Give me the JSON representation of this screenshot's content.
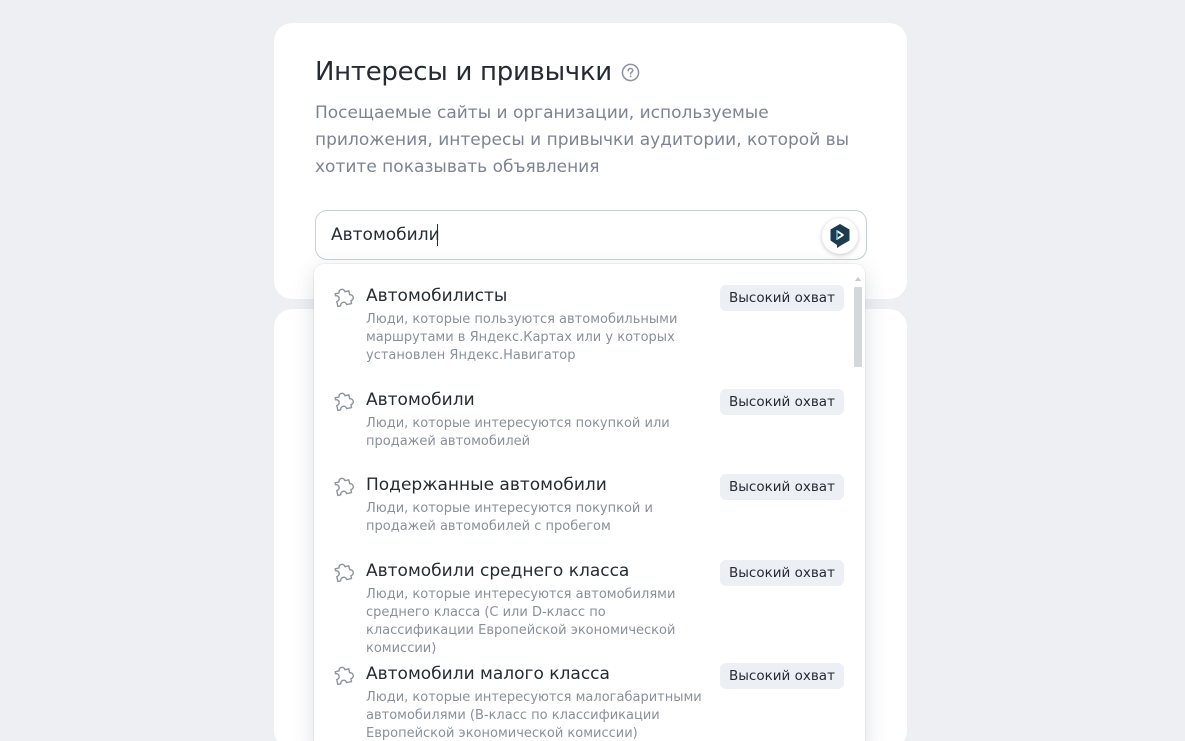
{
  "section": {
    "title": "Интересы и привычки",
    "description": "Посещаемые сайты и организации, используемые приложения, интересы и привычки аудитории, которой вы хотите показывать объявления"
  },
  "search": {
    "value": "Автомобили"
  },
  "colors": {
    "background": "#edeff3",
    "card": "#ffffff",
    "badge_bg": "#eceff4",
    "muted_text": "#8a909b"
  },
  "suggestions": [
    {
      "name": "Автомобилисты",
      "description": "Люди, которые пользуются автомобильными маршрутами в Яндекс.Картах или у которых установлен Яндекс.Навигатор",
      "badge": "Высокий охват",
      "icon": "puzzle-icon"
    },
    {
      "name": "Автомобили",
      "description": "Люди, которые интересуются покупкой или продажей автомобилей",
      "badge": "Высокий охват",
      "icon": "puzzle-icon"
    },
    {
      "name": "Подержанные автомобили",
      "description": "Люди, которые интересуются покупкой и продажей автомобилей с пробегом",
      "badge": "Высокий охват",
      "icon": "puzzle-icon"
    },
    {
      "name": "Автомобили среднего класса",
      "description": "Люди, которые интересуются автомобилями среднего класса (C или D-класс по классификации Европейской экономической комиссии)",
      "badge": "Высокий охват",
      "icon": "puzzle-icon"
    },
    {
      "name": "Автомобили малого класса",
      "description": "Люди, которые интересуются малогабаритными автомобилями (B-класс по классификации Европейской экономической комиссии)",
      "badge": "Высокий охват",
      "icon": "puzzle-icon"
    }
  ]
}
